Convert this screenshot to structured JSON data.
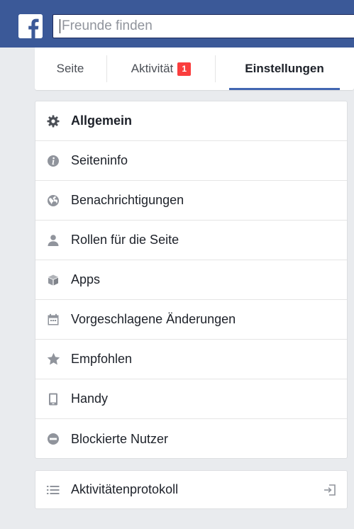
{
  "header": {
    "logo_letter": "f",
    "search": {
      "placeholder": "Freunde finden",
      "value": ""
    }
  },
  "tabs": [
    {
      "label": "Seite"
    },
    {
      "label": "Aktivität",
      "badge": "1"
    },
    {
      "label": "Einstellungen",
      "selected": true
    }
  ],
  "settings_menu": [
    {
      "label": "Allgemein",
      "icon": "gear-icon",
      "selected": true
    },
    {
      "label": "Seiteninfo",
      "icon": "info-icon"
    },
    {
      "label": "Benachrichtigungen",
      "icon": "globe-icon"
    },
    {
      "label": "Rollen für die Seite",
      "icon": "person-icon"
    },
    {
      "label": "Apps",
      "icon": "cube-icon"
    },
    {
      "label": "Vorgeschlagene Änderungen",
      "icon": "calendar-icon"
    },
    {
      "label": "Empfohlen",
      "icon": "star-icon"
    },
    {
      "label": "Handy",
      "icon": "phone-icon"
    },
    {
      "label": "Blockierte Nutzer",
      "icon": "blocked-icon"
    }
  ],
  "activity_log": {
    "label": "Aktivitätenprotokoll",
    "icon": "list-icon",
    "action_icon": "enter-icon"
  },
  "colors": {
    "brand_blue": "#3b5998",
    "tab_underline": "#4267b2",
    "badge_red": "#fa3e3e",
    "icon_gray": "#90949c",
    "background": "#e9ebee"
  }
}
